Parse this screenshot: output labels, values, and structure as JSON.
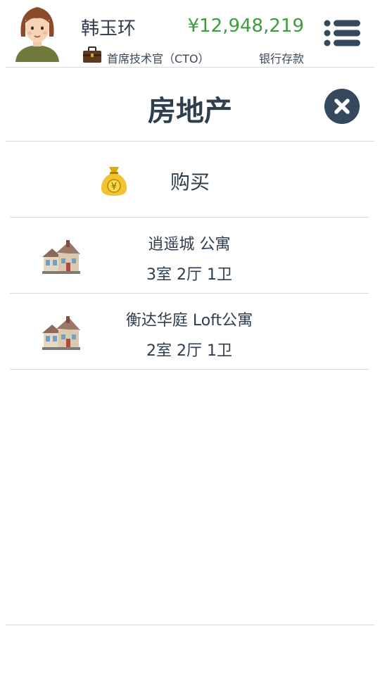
{
  "header": {
    "player_name": "韩玉环",
    "job_title": "首席技术官（CTO）",
    "money": "¥12,948,219",
    "money_label": "银行存款"
  },
  "page": {
    "title": "房地产"
  },
  "actions": {
    "buy_label": "购买"
  },
  "properties": [
    {
      "name": "逍遥城 公寓",
      "layout": "3室 2厅 1卫"
    },
    {
      "name": "衡达华庭 Loft公寓",
      "layout": "2室 2厅 1卫"
    }
  ],
  "colors": {
    "money": "#3e9c3e",
    "accent_dark": "#34495e",
    "text": "#2f3e4e"
  }
}
